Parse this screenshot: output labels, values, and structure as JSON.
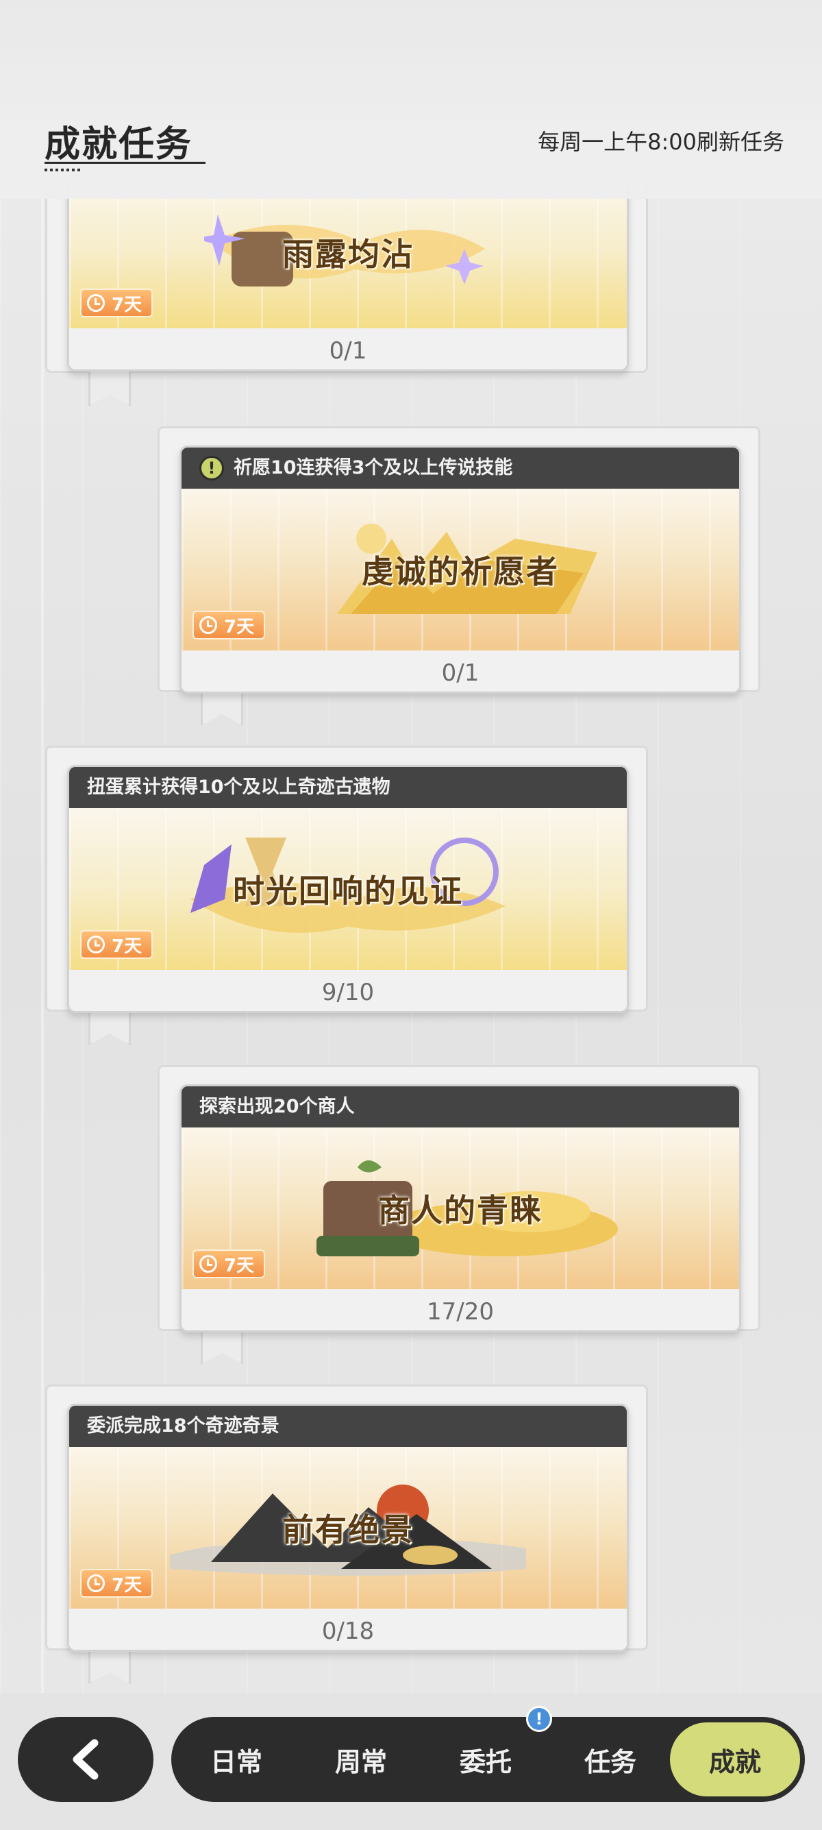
{
  "header": {
    "title": "成就任务",
    "refresh_note": "每周一上午8:00刷新任务"
  },
  "cards": [
    {
      "requirement": "",
      "banner_title": "雨露均沾",
      "duration": "7天",
      "progress": "0/1"
    },
    {
      "requirement": "祈愿10连获得3个及以上传说技能",
      "banner_title": "虔诚的祈愿者",
      "duration": "7天",
      "progress": "0/1"
    },
    {
      "requirement": "扭蛋累计获得10个及以上奇迹古遗物",
      "banner_title": "时光回响的见证",
      "duration": "7天",
      "progress": "9/10"
    },
    {
      "requirement": "探索出现20个商人",
      "banner_title": "商人的青睐",
      "duration": "7天",
      "progress": "17/20"
    },
    {
      "requirement": "委派完成18个奇迹奇景",
      "banner_title": "前有绝景",
      "duration": "7天",
      "progress": "0/18"
    }
  ],
  "nav": {
    "items": [
      "日常",
      "周常",
      "委托",
      "任务",
      "成就"
    ],
    "active": "成就",
    "notification_badge": "!"
  },
  "colors": {
    "active_tab": "#d4db7a",
    "nav_background": "#2c2c2c",
    "badge_orange": "#f29045",
    "card_header": "#444444"
  }
}
